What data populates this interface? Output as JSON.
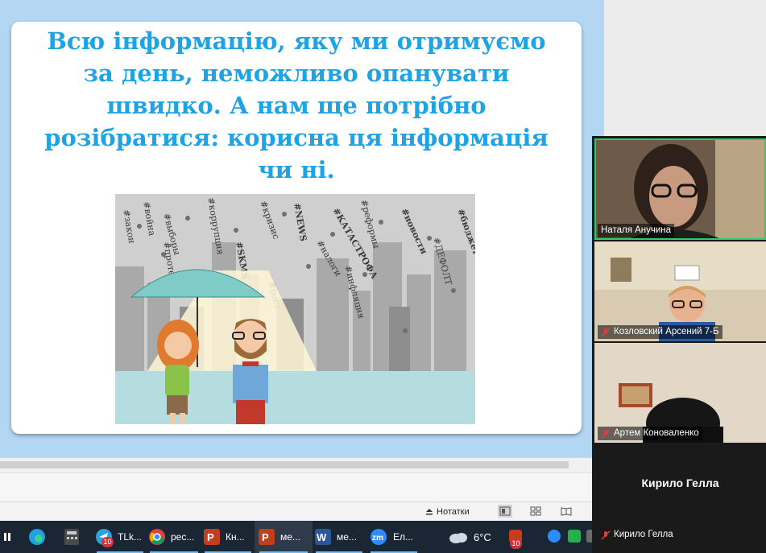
{
  "slide": {
    "title": "Всю інформацію, яку ми отримуємо\nза день, неможливо опанувати\nшвидко. А нам ще потрібно\nрозібратися: корисна ця інформація\nчи ні.",
    "image_hashtags": [
      "#бюджет",
      "#КАТАСТРОФА",
      "#выборы",
      "#кризис",
      "#NEWS",
      "#новости",
      "#война",
      "#протест",
      "#инфляция",
      "#закон",
      "#коррупция",
      "#реформы",
      "#SKMS",
      "#ДЕФОЛТ",
      "#налоги",
      "#рост"
    ]
  },
  "statusbar": {
    "notes_label": "Нотатки"
  },
  "taskbar": {
    "apps": [
      {
        "name": "TLk...",
        "badge": "10"
      },
      {
        "name": "рес..."
      },
      {
        "name": "Кн..."
      },
      {
        "name": "ме..."
      },
      {
        "name": "ме..."
      },
      {
        "name": "Ел..."
      }
    ],
    "weather": "6°C",
    "tray_badge": "10"
  },
  "participants": [
    {
      "name": "Наталя Анучина",
      "muted": false,
      "speaking": true
    },
    {
      "name": "Козловский Арсений 7-Б",
      "muted": true
    },
    {
      "name": "Артем Коноваленко",
      "muted": true
    },
    {
      "name": "Кирило Гелла",
      "muted": true,
      "display_name": "Кирило Гелла"
    }
  ],
  "colors": {
    "title": "#1ea3e4",
    "canvas": "#b3d6f3",
    "speaking_border": "#23d160",
    "taskbar": "#1b2634"
  }
}
